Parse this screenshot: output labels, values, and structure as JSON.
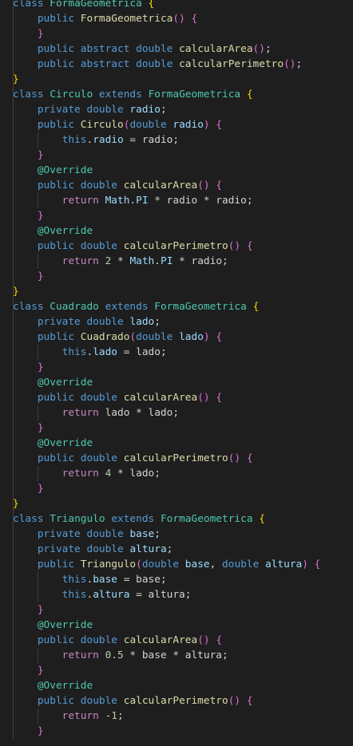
{
  "editor": {
    "language": "java",
    "lines": [
      [
        [
          "kw",
          "class"
        ],
        [
          "op",
          " "
        ],
        [
          "ty",
          "FormaGeometrica"
        ],
        [
          "op",
          " "
        ],
        [
          "b1",
          "{"
        ]
      ],
      [
        [
          "op",
          "    "
        ],
        [
          "kw",
          "public"
        ],
        [
          "op",
          " "
        ],
        [
          "fn",
          "FormaGeometrica"
        ],
        [
          "b2",
          "()"
        ],
        [
          "op",
          " "
        ],
        [
          "b2",
          "{"
        ]
      ],
      [
        [
          "op",
          "    "
        ],
        [
          "b2",
          "}"
        ]
      ],
      [
        [
          "op",
          "    "
        ],
        [
          "kw",
          "public"
        ],
        [
          "op",
          " "
        ],
        [
          "kw",
          "abstract"
        ],
        [
          "op",
          " "
        ],
        [
          "kw",
          "double"
        ],
        [
          "op",
          " "
        ],
        [
          "fn",
          "calcularArea"
        ],
        [
          "b2",
          "()"
        ],
        [
          "op",
          ";"
        ]
      ],
      [
        [
          "op",
          "    "
        ],
        [
          "kw",
          "public"
        ],
        [
          "op",
          " "
        ],
        [
          "kw",
          "abstract"
        ],
        [
          "op",
          " "
        ],
        [
          "kw",
          "double"
        ],
        [
          "op",
          " "
        ],
        [
          "fn",
          "calcularPerimetro"
        ],
        [
          "b2",
          "()"
        ],
        [
          "op",
          ";"
        ]
      ],
      [
        [
          "b1",
          "}"
        ]
      ],
      [
        [
          "kw",
          "class"
        ],
        [
          "op",
          " "
        ],
        [
          "ty",
          "Circulo"
        ],
        [
          "op",
          " "
        ],
        [
          "kw",
          "extends"
        ],
        [
          "op",
          " "
        ],
        [
          "ty",
          "FormaGeometrica"
        ],
        [
          "op",
          " "
        ],
        [
          "b1",
          "{"
        ]
      ],
      [
        [
          "op",
          "    "
        ],
        [
          "kw",
          "private"
        ],
        [
          "op",
          " "
        ],
        [
          "kw",
          "double"
        ],
        [
          "op",
          " "
        ],
        [
          "var",
          "radio"
        ],
        [
          "op",
          ";"
        ]
      ],
      [
        [
          "op",
          "    "
        ],
        [
          "kw",
          "public"
        ],
        [
          "op",
          " "
        ],
        [
          "fn",
          "Circulo"
        ],
        [
          "b2",
          "("
        ],
        [
          "kw",
          "double"
        ],
        [
          "op",
          " "
        ],
        [
          "var",
          "radio"
        ],
        [
          "b2",
          ")"
        ],
        [
          "op",
          " "
        ],
        [
          "b2",
          "{"
        ]
      ],
      [
        [
          "op",
          "        "
        ],
        [
          "kw",
          "this"
        ],
        [
          "op",
          "."
        ],
        [
          "var",
          "radio"
        ],
        [
          "op",
          " = radio;"
        ]
      ],
      [
        [
          "op",
          "    "
        ],
        [
          "b2",
          "}"
        ]
      ],
      [
        [
          "op",
          "    "
        ],
        [
          "ann",
          "@Override"
        ]
      ],
      [
        [
          "op",
          "    "
        ],
        [
          "kw",
          "public"
        ],
        [
          "op",
          " "
        ],
        [
          "kw",
          "double"
        ],
        [
          "op",
          " "
        ],
        [
          "fn",
          "calcularArea"
        ],
        [
          "b2",
          "()"
        ],
        [
          "op",
          " "
        ],
        [
          "b2",
          "{"
        ]
      ],
      [
        [
          "op",
          "        "
        ],
        [
          "kw2",
          "return"
        ],
        [
          "op",
          " "
        ],
        [
          "var",
          "Math"
        ],
        [
          "op",
          "."
        ],
        [
          "var",
          "PI"
        ],
        [
          "op",
          " * radio * radio;"
        ]
      ],
      [
        [
          "op",
          "    "
        ],
        [
          "b2",
          "}"
        ]
      ],
      [
        [
          "op",
          "    "
        ],
        [
          "ann",
          "@Override"
        ]
      ],
      [
        [
          "op",
          "    "
        ],
        [
          "kw",
          "public"
        ],
        [
          "op",
          " "
        ],
        [
          "kw",
          "double"
        ],
        [
          "op",
          " "
        ],
        [
          "fn",
          "calcularPerimetro"
        ],
        [
          "b2",
          "()"
        ],
        [
          "op",
          " "
        ],
        [
          "b2",
          "{"
        ]
      ],
      [
        [
          "op",
          "        "
        ],
        [
          "kw2",
          "return"
        ],
        [
          "op",
          " "
        ],
        [
          "num",
          "2"
        ],
        [
          "op",
          " * "
        ],
        [
          "var",
          "Math"
        ],
        [
          "op",
          "."
        ],
        [
          "var",
          "PI"
        ],
        [
          "op",
          " * radio;"
        ]
      ],
      [
        [
          "op",
          "    "
        ],
        [
          "b2",
          "}"
        ]
      ],
      [
        [
          "b1",
          "}"
        ]
      ],
      [
        [
          "kw",
          "class"
        ],
        [
          "op",
          " "
        ],
        [
          "ty",
          "Cuadrado"
        ],
        [
          "op",
          " "
        ],
        [
          "kw",
          "extends"
        ],
        [
          "op",
          " "
        ],
        [
          "ty",
          "FormaGeometrica"
        ],
        [
          "op",
          " "
        ],
        [
          "b1",
          "{"
        ]
      ],
      [
        [
          "op",
          "    "
        ],
        [
          "kw",
          "private"
        ],
        [
          "op",
          " "
        ],
        [
          "kw",
          "double"
        ],
        [
          "op",
          " "
        ],
        [
          "var",
          "lado"
        ],
        [
          "op",
          ";"
        ]
      ],
      [
        [
          "op",
          "    "
        ],
        [
          "kw",
          "public"
        ],
        [
          "op",
          " "
        ],
        [
          "fn",
          "Cuadrado"
        ],
        [
          "b2",
          "("
        ],
        [
          "kw",
          "double"
        ],
        [
          "op",
          " "
        ],
        [
          "var",
          "lado"
        ],
        [
          "b2",
          ")"
        ],
        [
          "op",
          " "
        ],
        [
          "b2",
          "{"
        ]
      ],
      [
        [
          "op",
          "        "
        ],
        [
          "kw",
          "this"
        ],
        [
          "op",
          "."
        ],
        [
          "var",
          "lado"
        ],
        [
          "op",
          " = lado;"
        ]
      ],
      [
        [
          "op",
          "    "
        ],
        [
          "b2",
          "}"
        ]
      ],
      [
        [
          "op",
          "    "
        ],
        [
          "ann",
          "@Override"
        ]
      ],
      [
        [
          "op",
          "    "
        ],
        [
          "kw",
          "public"
        ],
        [
          "op",
          " "
        ],
        [
          "kw",
          "double"
        ],
        [
          "op",
          " "
        ],
        [
          "fn",
          "calcularArea"
        ],
        [
          "b2",
          "()"
        ],
        [
          "op",
          " "
        ],
        [
          "b2",
          "{"
        ]
      ],
      [
        [
          "op",
          "        "
        ],
        [
          "kw2",
          "return"
        ],
        [
          "op",
          " lado * lado;"
        ]
      ],
      [
        [
          "op",
          "    "
        ],
        [
          "b2",
          "}"
        ]
      ],
      [
        [
          "op",
          "    "
        ],
        [
          "ann",
          "@Override"
        ]
      ],
      [
        [
          "op",
          "    "
        ],
        [
          "kw",
          "public"
        ],
        [
          "op",
          " "
        ],
        [
          "kw",
          "double"
        ],
        [
          "op",
          " "
        ],
        [
          "fn",
          "calcularPerimetro"
        ],
        [
          "b2",
          "()"
        ],
        [
          "op",
          " "
        ],
        [
          "b2",
          "{"
        ]
      ],
      [
        [
          "op",
          "        "
        ],
        [
          "kw2",
          "return"
        ],
        [
          "op",
          " "
        ],
        [
          "num",
          "4"
        ],
        [
          "op",
          " * lado;"
        ]
      ],
      [
        [
          "op",
          "    "
        ],
        [
          "b2",
          "}"
        ]
      ],
      [
        [
          "b1",
          "}"
        ]
      ],
      [
        [
          "kw",
          "class"
        ],
        [
          "op",
          " "
        ],
        [
          "ty",
          "Triangulo"
        ],
        [
          "op",
          " "
        ],
        [
          "kw",
          "extends"
        ],
        [
          "op",
          " "
        ],
        [
          "ty",
          "FormaGeometrica"
        ],
        [
          "op",
          " "
        ],
        [
          "b1",
          "{"
        ]
      ],
      [
        [
          "op",
          "    "
        ],
        [
          "kw",
          "private"
        ],
        [
          "op",
          " "
        ],
        [
          "kw",
          "double"
        ],
        [
          "op",
          " "
        ],
        [
          "var",
          "base"
        ],
        [
          "op",
          ";"
        ]
      ],
      [
        [
          "op",
          "    "
        ],
        [
          "kw",
          "private"
        ],
        [
          "op",
          " "
        ],
        [
          "kw",
          "double"
        ],
        [
          "op",
          " "
        ],
        [
          "var",
          "altura"
        ],
        [
          "op",
          ";"
        ]
      ],
      [
        [
          "op",
          "    "
        ],
        [
          "kw",
          "public"
        ],
        [
          "op",
          " "
        ],
        [
          "fn",
          "Triangulo"
        ],
        [
          "b2",
          "("
        ],
        [
          "kw",
          "double"
        ],
        [
          "op",
          " "
        ],
        [
          "var",
          "base"
        ],
        [
          "op",
          ", "
        ],
        [
          "kw",
          "double"
        ],
        [
          "op",
          " "
        ],
        [
          "var",
          "altura"
        ],
        [
          "b2",
          ")"
        ],
        [
          "op",
          " "
        ],
        [
          "b2",
          "{"
        ]
      ],
      [
        [
          "op",
          "        "
        ],
        [
          "kw",
          "this"
        ],
        [
          "op",
          "."
        ],
        [
          "var",
          "base"
        ],
        [
          "op",
          " = base;"
        ]
      ],
      [
        [
          "op",
          "        "
        ],
        [
          "kw",
          "this"
        ],
        [
          "op",
          "."
        ],
        [
          "var",
          "altura"
        ],
        [
          "op",
          " = altura;"
        ]
      ],
      [
        [
          "op",
          "    "
        ],
        [
          "b2",
          "}"
        ]
      ],
      [
        [
          "op",
          "    "
        ],
        [
          "ann",
          "@Override"
        ]
      ],
      [
        [
          "op",
          "    "
        ],
        [
          "kw",
          "public"
        ],
        [
          "op",
          " "
        ],
        [
          "kw",
          "double"
        ],
        [
          "op",
          " "
        ],
        [
          "fn",
          "calcularArea"
        ],
        [
          "b2",
          "()"
        ],
        [
          "op",
          " "
        ],
        [
          "b2",
          "{"
        ]
      ],
      [
        [
          "op",
          "        "
        ],
        [
          "kw2",
          "return"
        ],
        [
          "op",
          " "
        ],
        [
          "num",
          "0.5"
        ],
        [
          "op",
          " * base * altura;"
        ]
      ],
      [
        [
          "op",
          "    "
        ],
        [
          "b2",
          "}"
        ]
      ],
      [
        [
          "op",
          "    "
        ],
        [
          "ann",
          "@Override"
        ]
      ],
      [
        [
          "op",
          "    "
        ],
        [
          "kw",
          "public"
        ],
        [
          "op",
          " "
        ],
        [
          "kw",
          "double"
        ],
        [
          "op",
          " "
        ],
        [
          "fn",
          "calcularPerimetro"
        ],
        [
          "b2",
          "()"
        ],
        [
          "op",
          " "
        ],
        [
          "b2",
          "{"
        ]
      ],
      [
        [
          "op",
          "        "
        ],
        [
          "kw2",
          "return"
        ],
        [
          "op",
          " -"
        ],
        [
          "num",
          "1"
        ],
        [
          "op",
          ";"
        ]
      ],
      [
        [
          "op",
          "    "
        ],
        [
          "b2",
          "}"
        ]
      ]
    ]
  }
}
